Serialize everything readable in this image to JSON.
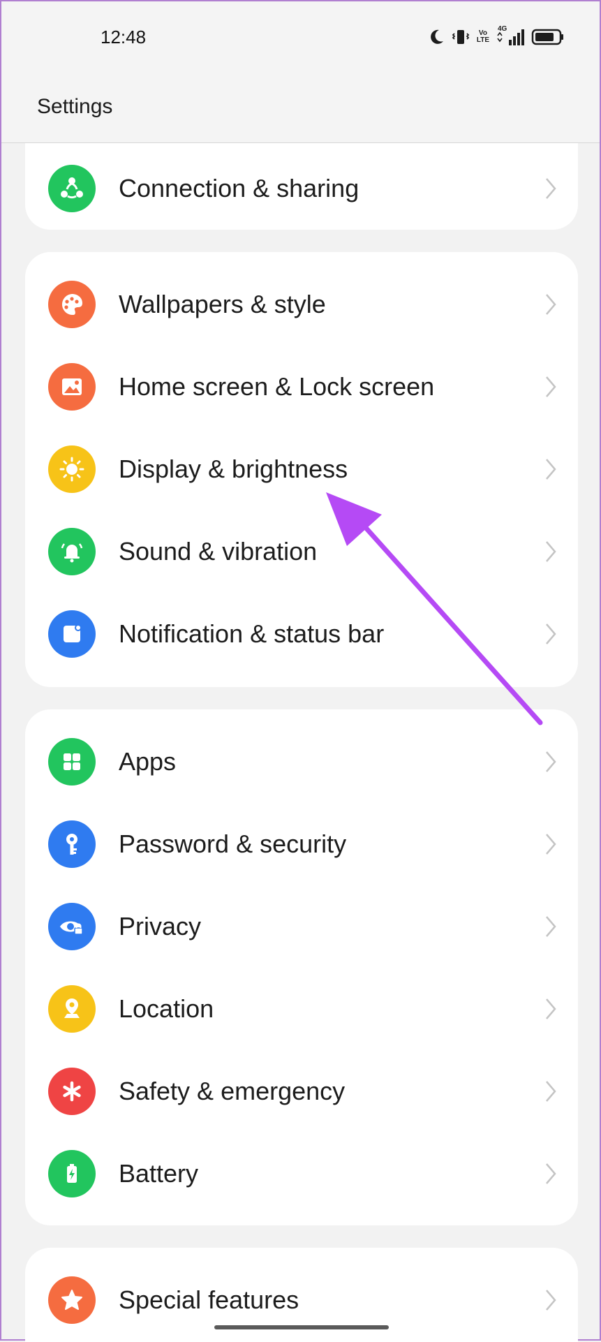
{
  "status_bar": {
    "time": "12:48",
    "volte_top": "Vo",
    "volte_bottom": "LTE",
    "network": "4G",
    "icons": [
      "moon-icon",
      "vibrate-icon",
      "volte-icon",
      "signal-icon",
      "battery-icon"
    ]
  },
  "header": {
    "title": "Settings"
  },
  "groups": [
    {
      "items": [
        {
          "label": "Connection & sharing",
          "icon": "share-icon",
          "color": "#22c55e"
        }
      ]
    },
    {
      "items": [
        {
          "label": "Wallpapers & style",
          "icon": "palette-icon",
          "color": "#f56c40"
        },
        {
          "label": "Home screen & Lock screen",
          "icon": "image-icon",
          "color": "#f56c40"
        },
        {
          "label": "Display & brightness",
          "icon": "sun-icon",
          "color": "#f7c318"
        },
        {
          "label": "Sound & vibration",
          "icon": "bell-icon",
          "color": "#22c55e"
        },
        {
          "label": "Notification & status bar",
          "icon": "notification-icon",
          "color": "#2f7bf0"
        }
      ]
    },
    {
      "items": [
        {
          "label": "Apps",
          "icon": "apps-grid-icon",
          "color": "#22c55e"
        },
        {
          "label": "Password & security",
          "icon": "key-icon",
          "color": "#2f7bf0"
        },
        {
          "label": "Privacy",
          "icon": "eye-lock-icon",
          "color": "#2f7bf0"
        },
        {
          "label": "Location",
          "icon": "location-pin-icon",
          "color": "#f7c318"
        },
        {
          "label": "Safety & emergency",
          "icon": "asterisk-icon",
          "color": "#ef4444"
        },
        {
          "label": "Battery",
          "icon": "battery-icon",
          "color": "#22c55e"
        }
      ]
    },
    {
      "items": [
        {
          "label": "Special features",
          "icon": "star-icon",
          "color": "#f56c40"
        }
      ]
    }
  ],
  "annotation": {
    "arrow_color": "#b54af5"
  }
}
